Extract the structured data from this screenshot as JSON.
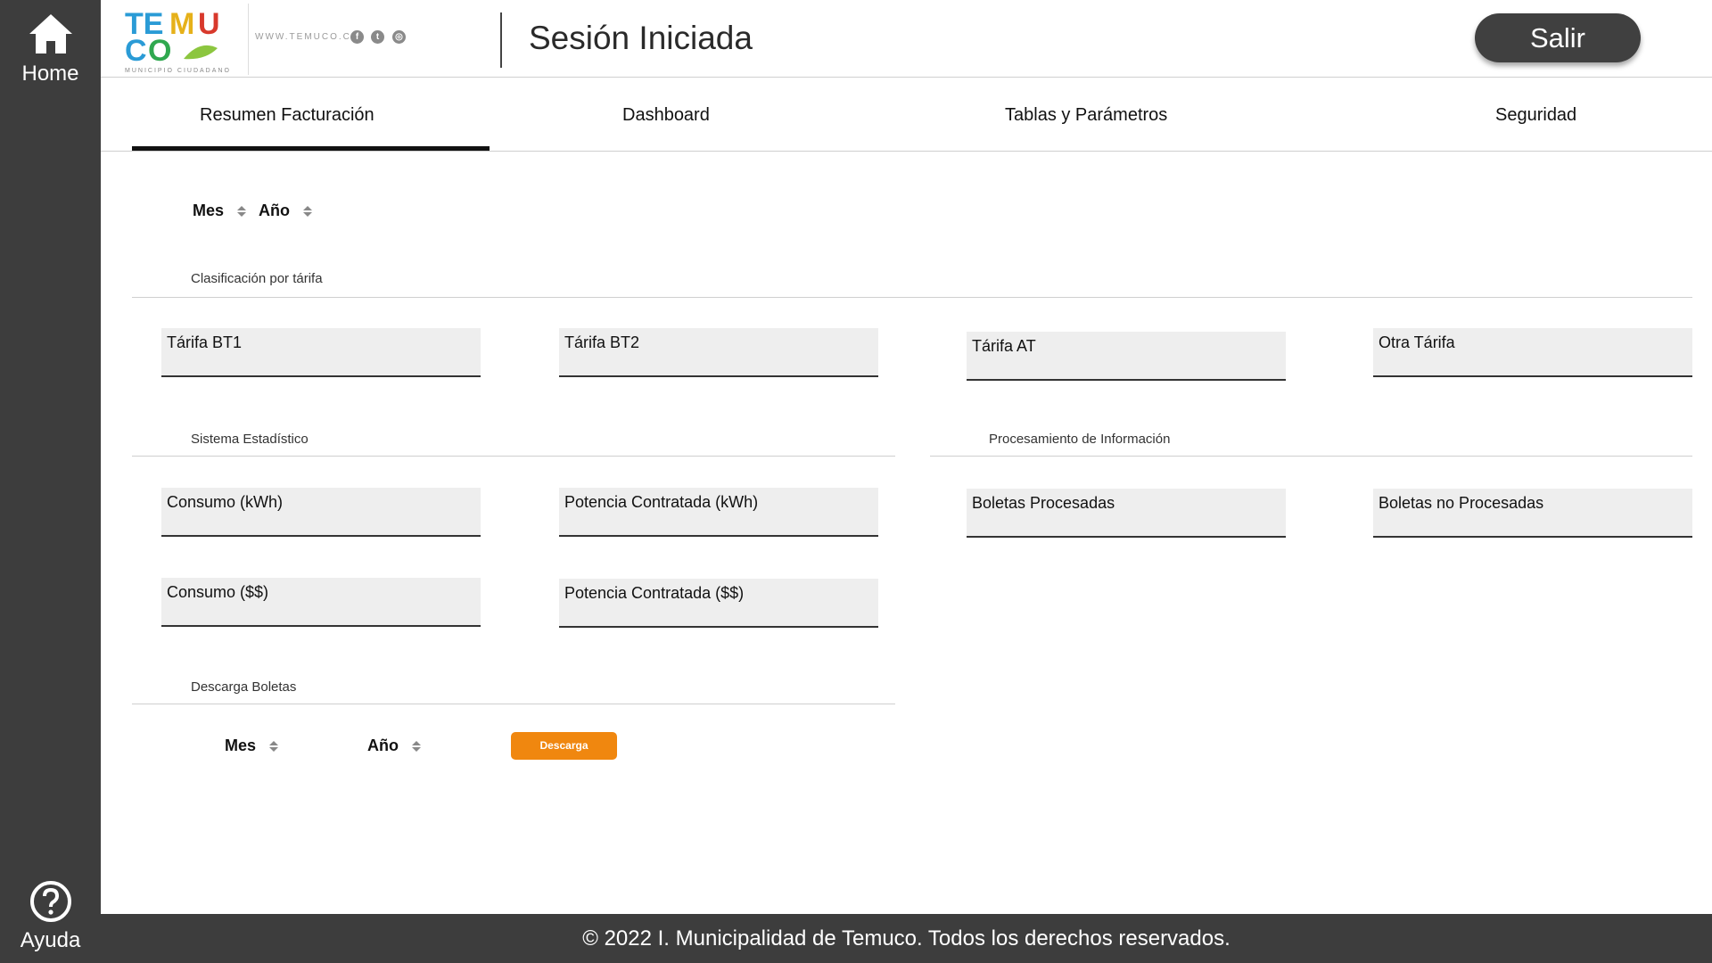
{
  "sidebar": {
    "home_label": "Home",
    "help_label": "Ayuda",
    "home_icon": "home-icon",
    "help_icon": "question-circle-icon"
  },
  "header": {
    "logo_text": "TEMUCO",
    "logo_subtitle": "MUNICIPIO CIUDADANO",
    "site_url": "WWW.TEMUCO.CL",
    "social_icons": [
      "facebook-icon",
      "twitter-icon",
      "instagram-icon"
    ],
    "title": "Sesión Iniciada",
    "logout_label": "Salir"
  },
  "tabs": [
    {
      "label": "Resumen Facturación",
      "active": true
    },
    {
      "label": "Dashboard",
      "active": false
    },
    {
      "label": "Tablas y Parámetros",
      "active": false
    },
    {
      "label": "Seguridad",
      "active": false
    }
  ],
  "filters": {
    "month_label": "Mes",
    "year_label": "Año"
  },
  "tariff_section": {
    "title": "Clasificación por tárifa",
    "fields": [
      "Tárifa BT1",
      "Tárifa BT2",
      "Tárifa AT",
      "Otra Tárifa"
    ]
  },
  "stats_section": {
    "title": "Sistema Estadístico",
    "fields": [
      "Consumo (kWh)",
      "Potencia Contratada (kWh)",
      "Consumo ($$)",
      "Potencia Contratada ($$)"
    ]
  },
  "processing_section": {
    "title": "Procesamiento de Información",
    "fields": [
      "Boletas Procesadas",
      "Boletas no Procesadas"
    ]
  },
  "download_section": {
    "title": "Descarga Boletas",
    "month_label": "Mes",
    "year_label": "Año",
    "button_label": "Descarga"
  },
  "footer": {
    "text": "© 2022 I. Municipalidad de Temuco. Todos los derechos reservados."
  },
  "colors": {
    "sidebar_bg": "#3d3d3d",
    "accent": "#f0870f",
    "field_bg": "#eeeeee"
  }
}
